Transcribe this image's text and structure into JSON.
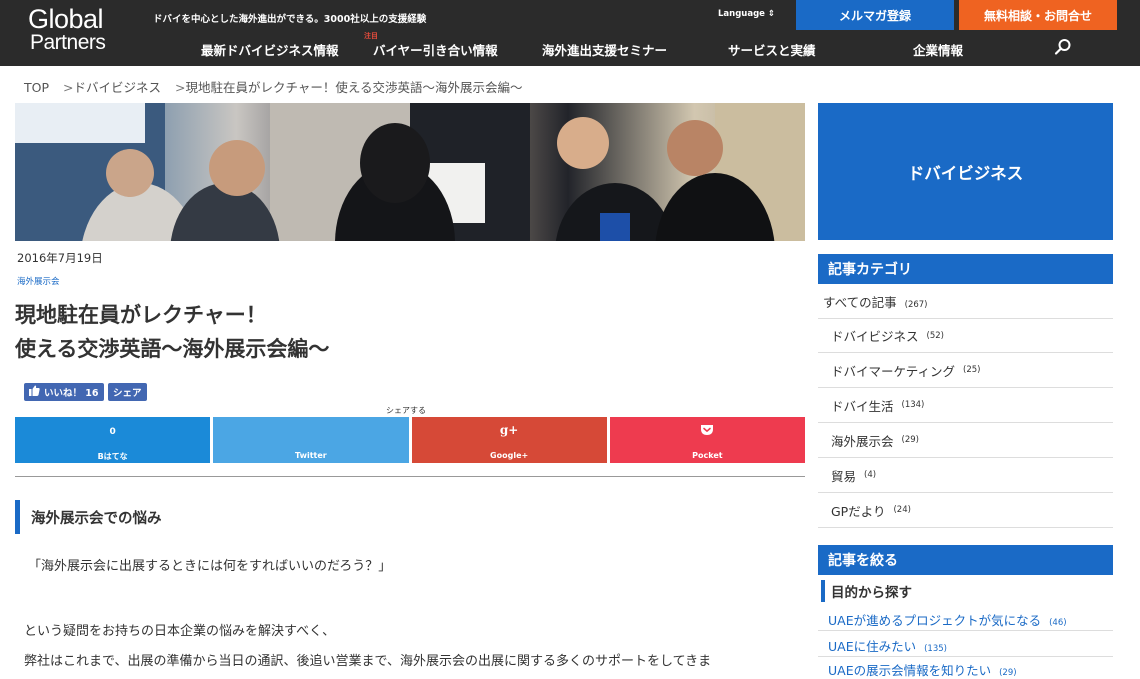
{
  "header": {
    "logo_line1": "Global",
    "logo_line2": "Partners",
    "tagline": "ドバイを中心とした海外進出ができる。3000社以上の支援経験",
    "language": "Language ⇕",
    "mail_btn": "メルマガ登録",
    "consult_btn": "無料相談・お問合せ",
    "nav": [
      {
        "label": "最新ドバイビジネス情報"
      },
      {
        "label": "バイヤー引き合い情報",
        "badge": "注目"
      },
      {
        "label": "海外進出支援セミナー"
      },
      {
        "label": "サービスと実績"
      },
      {
        "label": "企業情報"
      }
    ]
  },
  "breadcrumb": [
    "TOP",
    "ドバイビジネス",
    "現地駐在員がレクチャー！使える交渉英語〜海外展示会編〜"
  ],
  "breadcrumb_sep": ">",
  "article": {
    "date": "2016年7月19日",
    "category": "海外展示会",
    "title_line1": "現地駐在員がレクチャー！",
    "title_line2": "使える交渉英語〜海外展示会編〜",
    "fb_like": "いいね！ 16",
    "fb_share": "シェア",
    "share_title": "シェアする",
    "share_buttons": [
      {
        "top": "0",
        "label": "Bはてな"
      },
      {
        "top": "",
        "label": "Twitter"
      },
      {
        "top": "g+",
        "label": "Google+"
      },
      {
        "top": "",
        "label": "Pocket"
      }
    ],
    "section_heading": "海外展示会での悩み",
    "p1": "「海外展示会に出展するときには何をすればいいのだろう？」",
    "p2": "という疑問をお持ちの日本企業の悩みを解決すべく、",
    "p3": "弊社はこれまで、出展の準備から当日の通訳、後追い営業まで、海外展示会の出展に関する多くのサポートをしてきま"
  },
  "sidebar": {
    "banner": "ドバイビジネス",
    "category_heading": "記事カテゴリ",
    "all": {
      "label": "すべての記事",
      "count": "(267)"
    },
    "categories": [
      {
        "label": "ドバイビジネス",
        "count": "(52)"
      },
      {
        "label": "ドバイマーケティング",
        "count": "(25)"
      },
      {
        "label": "ドバイ生活",
        "count": "(134)"
      },
      {
        "label": "海外展示会",
        "count": "(29)"
      },
      {
        "label": "貿易",
        "count": "(4)"
      },
      {
        "label": "GPだより",
        "count": "(24)"
      }
    ],
    "filter_heading": "記事を絞る",
    "filter_sub": "目的から探す",
    "links": [
      {
        "label": "UAEが進めるプロジェクトが気になる",
        "count": "(46)"
      },
      {
        "label": "UAEに住みたい",
        "count": "(135)"
      },
      {
        "label": "UAEの展示会情報を知りたい",
        "count": "(29)"
      }
    ]
  },
  "colors": {
    "accent": "#1a6ac6",
    "header_bg": "#2b2b2b",
    "consult": "#ef6321"
  }
}
